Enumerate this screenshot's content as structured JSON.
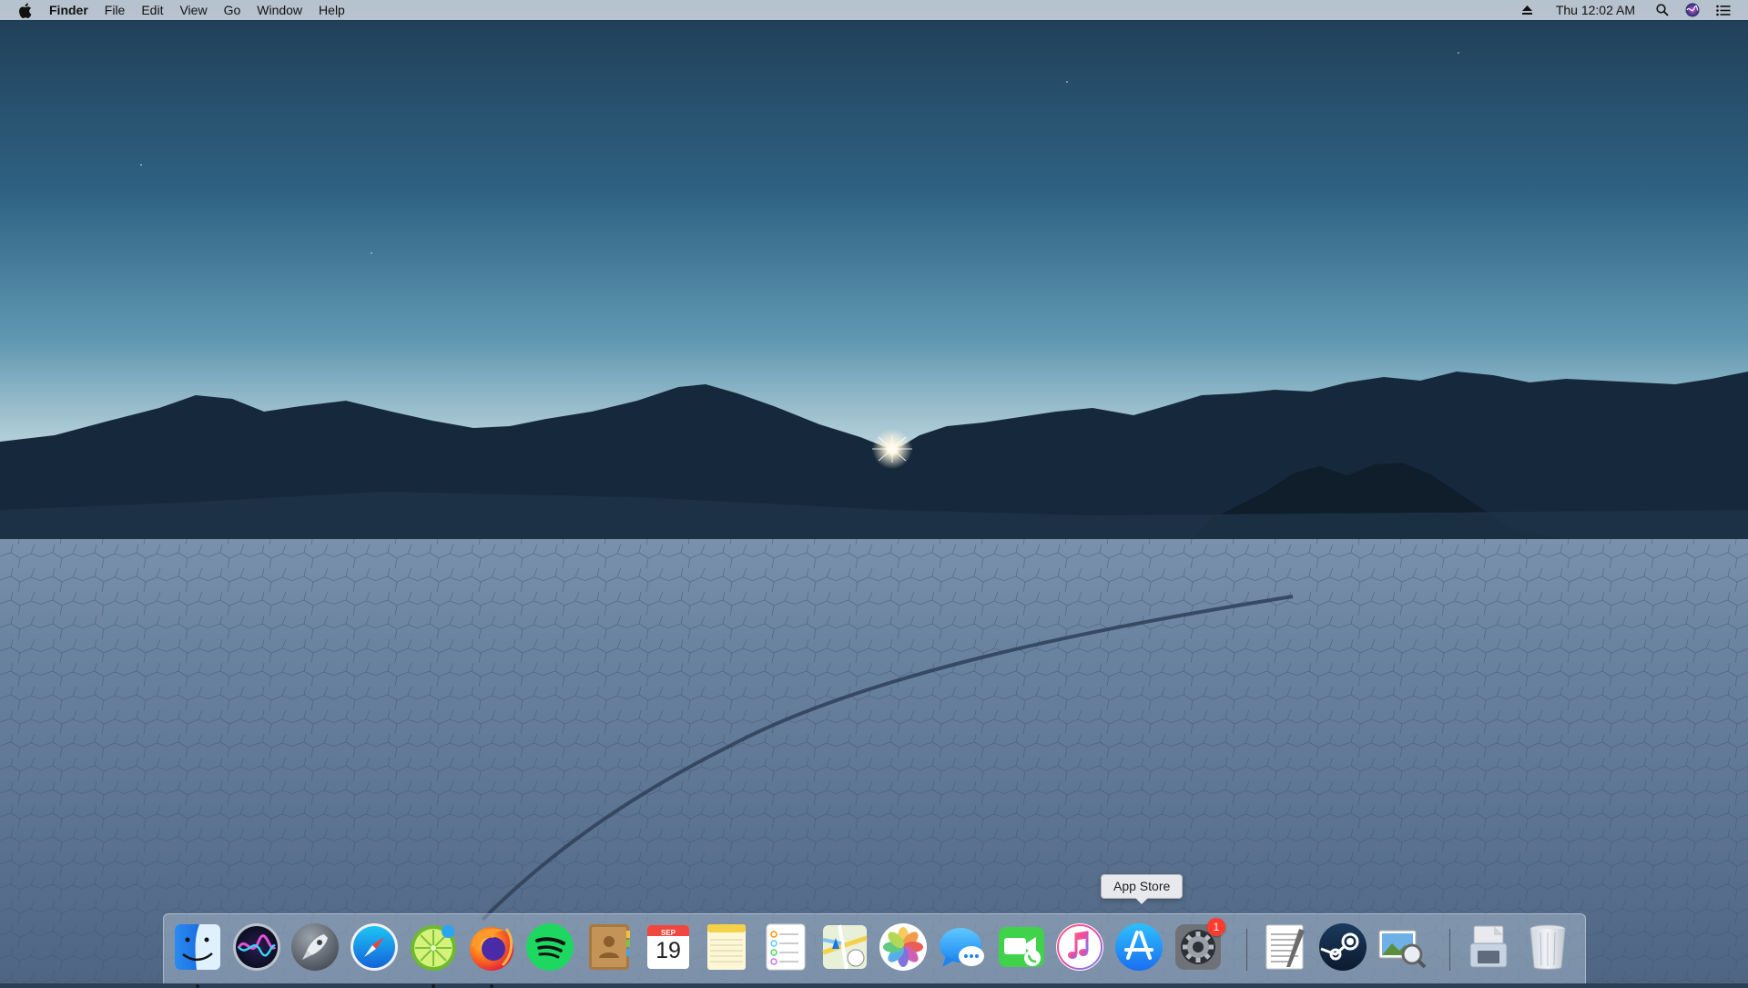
{
  "menubar": {
    "apple_icon": "apple-logo-icon",
    "app_name": "Finder",
    "menus": [
      "File",
      "Edit",
      "View",
      "Go",
      "Window",
      "Help"
    ],
    "status_icons": [
      "eject-icon",
      "spotlight-search-icon",
      "siri-icon",
      "notification-center-icon"
    ],
    "clock": "Thu 12:02 AM"
  },
  "tooltip": {
    "text": "App Store"
  },
  "dock": {
    "apps": [
      {
        "name": "Finder",
        "icon": "finder-icon",
        "running": true
      },
      {
        "name": "Siri",
        "icon": "siri-icon",
        "running": false
      },
      {
        "name": "Launchpad",
        "icon": "launchpad-icon",
        "running": false
      },
      {
        "name": "Safari",
        "icon": "safari-icon",
        "running": false
      },
      {
        "name": "LimeChat",
        "icon": "limechat-icon",
        "running": true
      },
      {
        "name": "Firefox",
        "icon": "firefox-icon",
        "running": true
      },
      {
        "name": "Spotify",
        "icon": "spotify-icon",
        "running": false
      },
      {
        "name": "Contacts",
        "icon": "contacts-icon",
        "running": false
      },
      {
        "name": "Calendar",
        "icon": "calendar-icon",
        "running": false,
        "month": "SEP",
        "day": "19"
      },
      {
        "name": "Notes",
        "icon": "notes-icon",
        "running": false
      },
      {
        "name": "Reminders",
        "icon": "reminders-icon",
        "running": false
      },
      {
        "name": "Maps",
        "icon": "maps-icon",
        "running": false
      },
      {
        "name": "Photos",
        "icon": "photos-icon",
        "running": false
      },
      {
        "name": "Messages",
        "icon": "messages-icon",
        "running": false
      },
      {
        "name": "FaceTime",
        "icon": "facetime-icon",
        "running": false
      },
      {
        "name": "iTunes",
        "icon": "itunes-icon",
        "running": false
      },
      {
        "name": "App Store",
        "icon": "app-store-icon",
        "running": false
      },
      {
        "name": "System Preferences",
        "icon": "system-preferences-icon",
        "running": false,
        "badge": "1"
      },
      {
        "name": "TextEdit",
        "icon": "textedit-icon",
        "running": false
      },
      {
        "name": "Steam",
        "icon": "steam-icon",
        "running": false
      },
      {
        "name": "Preview",
        "icon": "preview-icon",
        "running": false
      },
      {
        "name": "Downloads",
        "icon": "downloads-stack-icon",
        "running": false
      },
      {
        "name": "Trash",
        "icon": "trash-icon",
        "running": false
      }
    ]
  },
  "colors": {
    "sky_top": "#1f3c55",
    "sky_mid": "#4f86a3",
    "horizon_glow": "#f2e6ea",
    "mountains": "#15283a",
    "playa": "#5d7693",
    "badge_red": "#ff3b30"
  }
}
